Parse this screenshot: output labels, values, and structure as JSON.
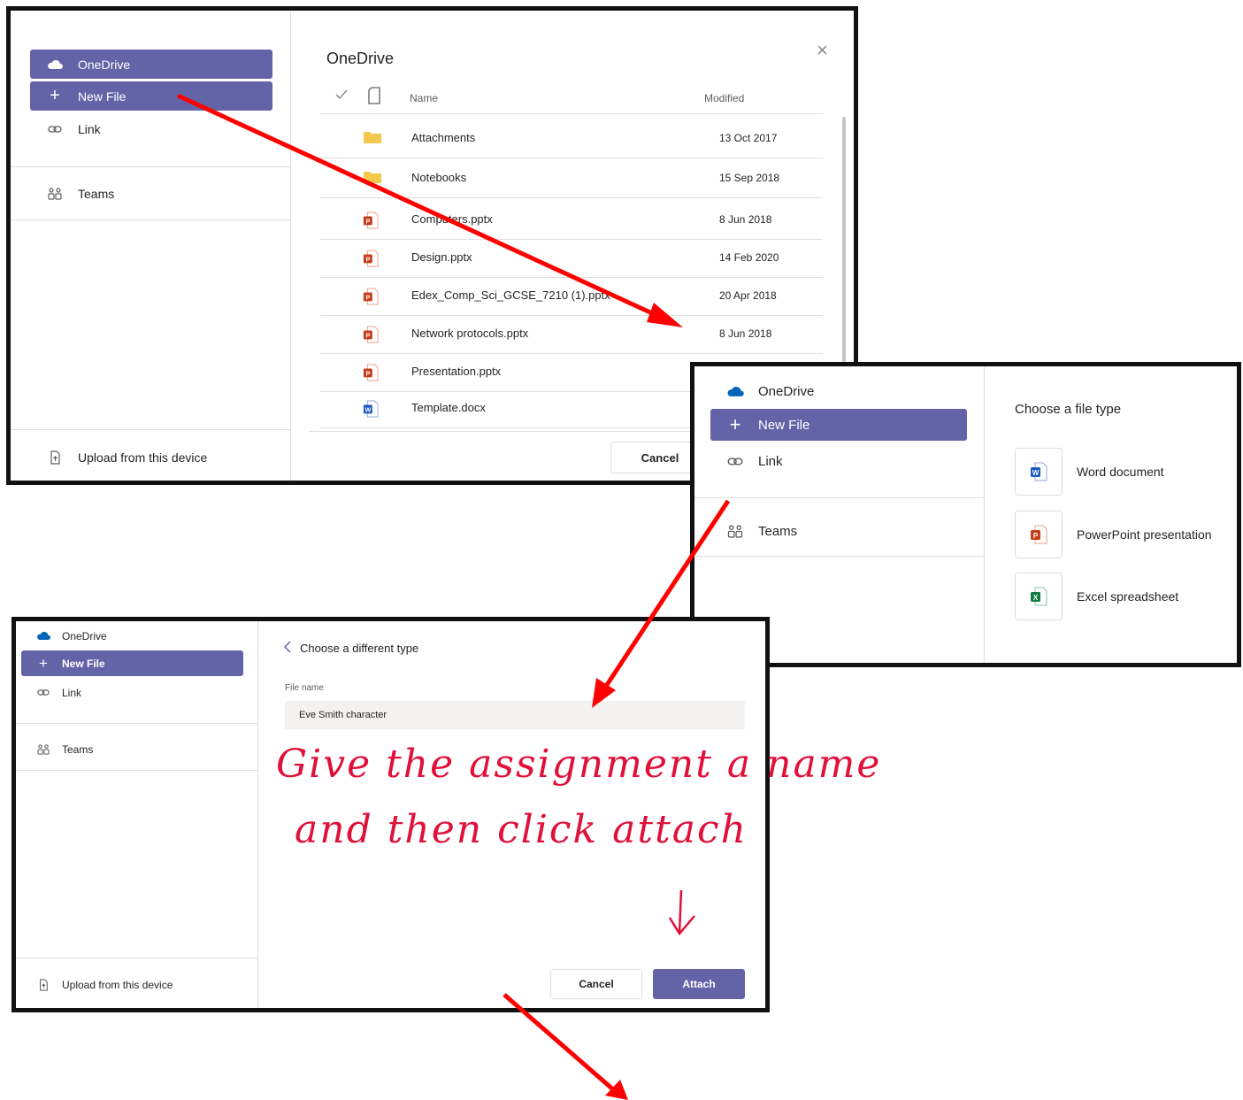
{
  "panel1": {
    "sidebar": {
      "onedrive_label": "OneDrive",
      "new_file_label": "New File",
      "link_label": "Link",
      "teams_label": "Teams",
      "upload_label": "Upload from this device"
    },
    "title": "OneDrive",
    "columns": {
      "name": "Name",
      "modified": "Modified"
    },
    "files": [
      {
        "name": "Attachments",
        "modified": "13 Oct 2017",
        "icon": "folder-icon"
      },
      {
        "name": "Notebooks",
        "modified": "15 Sep 2018",
        "icon": "folder-icon"
      },
      {
        "name": "Computers.pptx",
        "modified": "8 Jun 2018",
        "icon": "powerpoint-icon"
      },
      {
        "name": "Design.pptx",
        "modified": "14 Feb 2020",
        "icon": "powerpoint-icon"
      },
      {
        "name": "Edex_Comp_Sci_GCSE_7210 (1).pptx",
        "modified": "20 Apr 2018",
        "icon": "powerpoint-icon"
      },
      {
        "name": "Network protocols.pptx",
        "modified": "8 Jun 2018",
        "icon": "powerpoint-icon"
      },
      {
        "name": "Presentation.pptx",
        "modified": "",
        "icon": "powerpoint-icon"
      },
      {
        "name": "Template.docx",
        "modified": "",
        "icon": "word-icon"
      }
    ],
    "cancel_label": "Cancel"
  },
  "panel2": {
    "sidebar": {
      "onedrive_label": "OneDrive",
      "new_file_label": "New File",
      "link_label": "Link",
      "teams_label": "Teams"
    },
    "choose_title": "Choose a file type",
    "types": [
      {
        "label": "Word document",
        "icon": "word-icon"
      },
      {
        "label": "PowerPoint presentation",
        "icon": "powerpoint-icon"
      },
      {
        "label": "Excel spreadsheet",
        "icon": "excel-icon"
      }
    ]
  },
  "panel3": {
    "sidebar": {
      "onedrive_label": "OneDrive",
      "new_file_label": "New File",
      "link_label": "Link",
      "teams_label": "Teams",
      "upload_label": "Upload from this device"
    },
    "back_label": "Choose a different type",
    "file_name_label": "File name",
    "file_name_value": "Eve Smith character",
    "cancel_label": "Cancel",
    "attach_label": "Attach"
  },
  "annotation": {
    "line1": "Give the assignment a name",
    "line2": "and then click attach"
  },
  "colors": {
    "accent": "#6264a7",
    "arrow": "#ff0000",
    "handwriting": "#e0103a",
    "onedrive": "#0364b8",
    "word": "#185abd",
    "powerpoint": "#c43e1c",
    "excel": "#107c41",
    "folder": "#f2c94c"
  }
}
